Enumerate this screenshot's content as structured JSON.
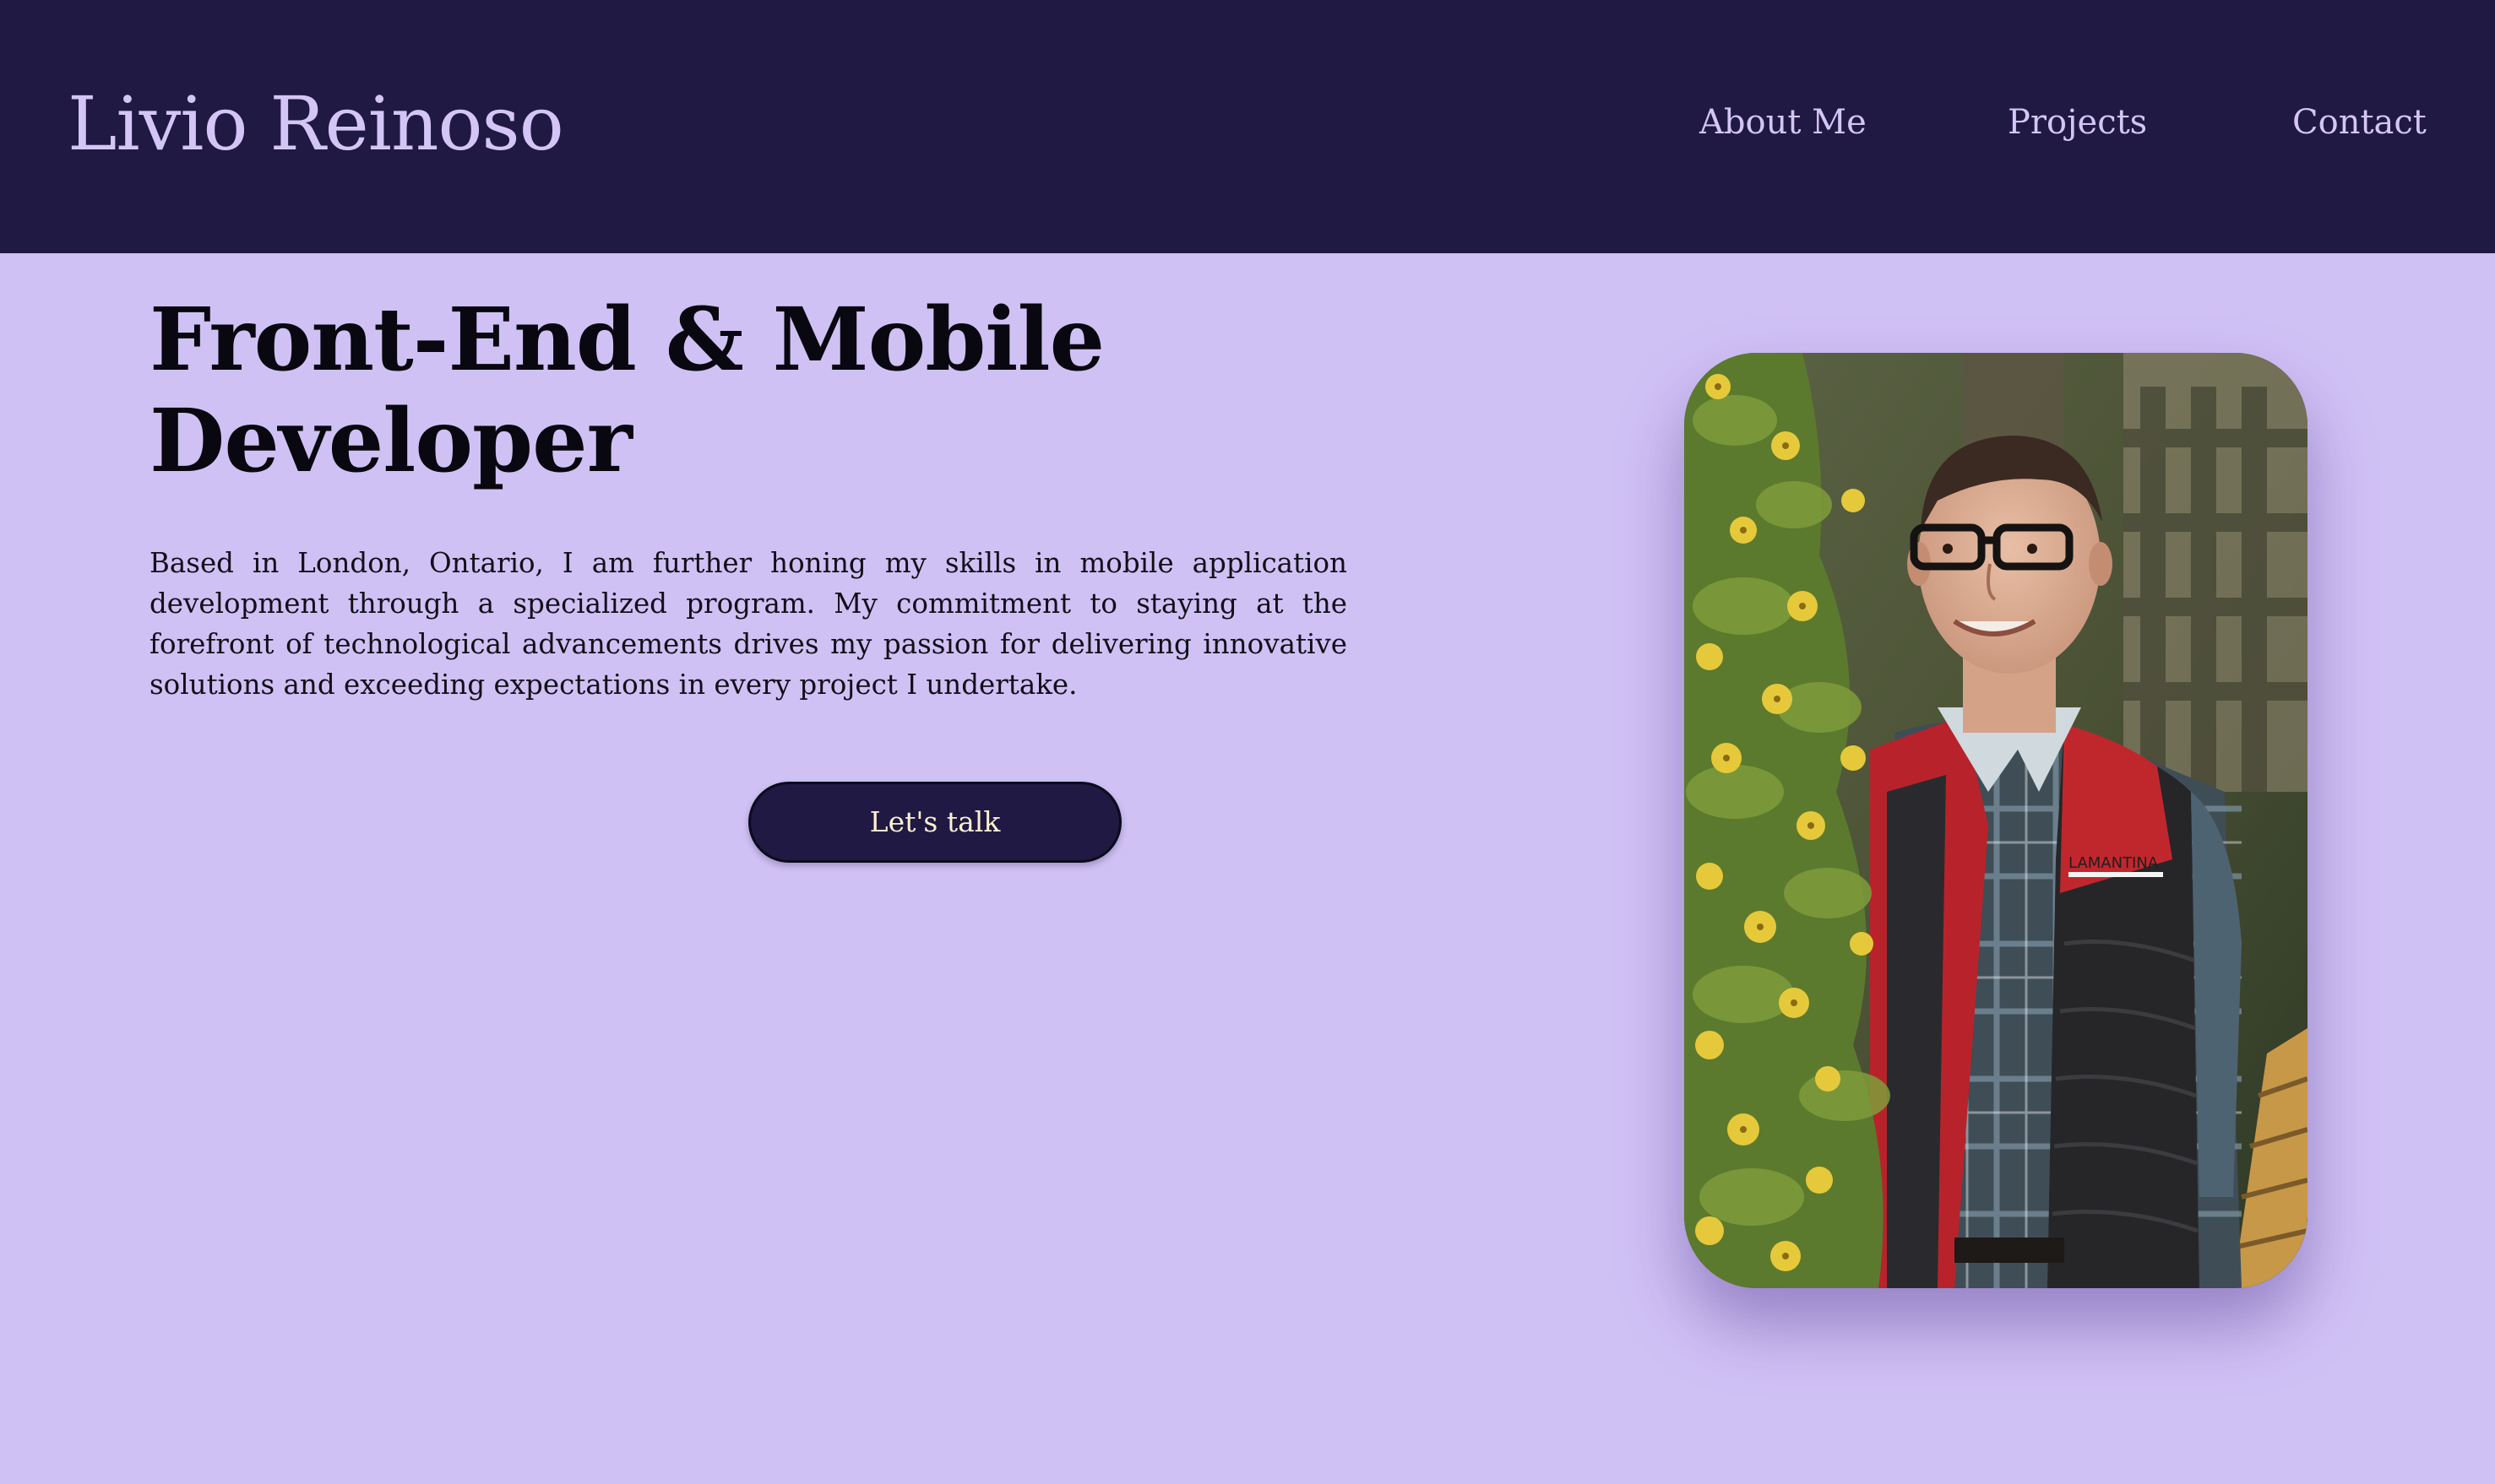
{
  "header": {
    "brand": "Livio Reinoso",
    "nav": {
      "about": "About Me",
      "projects": "Projects",
      "contact": "Contact"
    }
  },
  "hero": {
    "title": "Front-End & Mobile Developer",
    "description": "Based in London, Ontario, I am further honing my skills in mobile application development through a specialized program. My commitment to staying at the forefront of technological advancements drives my passion for delivering innovative solutions and exceeding expectations in every project I undertake.",
    "cta_label": "Let's talk"
  },
  "photo": {
    "vest_text": "LAMANTINA"
  },
  "colors": {
    "header_bg": "#201943",
    "page_bg": "#d0c1f5",
    "brand_text": "#d3c6f6",
    "button_bg": "#201943",
    "button_text": "#fbf0cf"
  }
}
